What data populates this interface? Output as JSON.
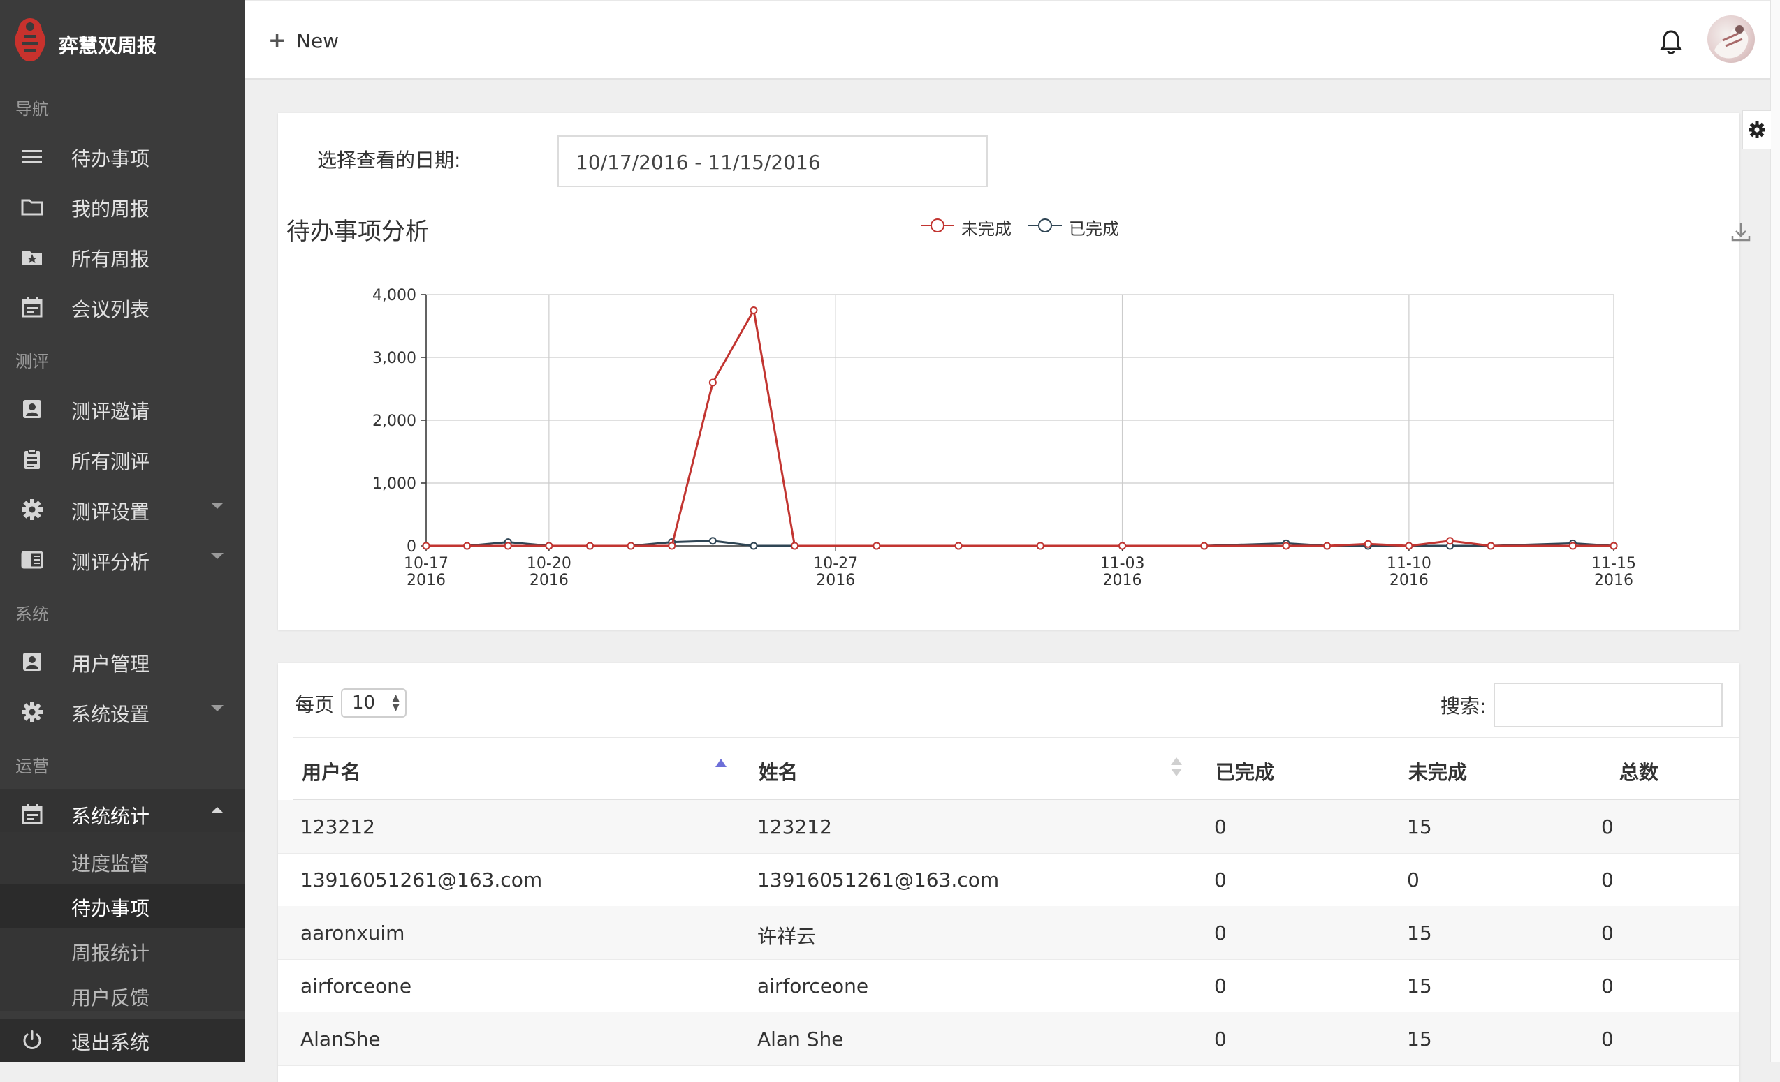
{
  "app": {
    "brand_title": "弈慧双周报",
    "logo_color": "#c8322d"
  },
  "sidebar": {
    "sections": [
      "导航",
      "测评",
      "系统",
      "运营"
    ],
    "items": [
      {
        "label": "待办事项",
        "icon": "menu-icon"
      },
      {
        "label": "我的周报",
        "icon": "folder-icon"
      },
      {
        "label": "所有周报",
        "icon": "star-folder-icon"
      },
      {
        "label": "会议列表",
        "icon": "calendar-icon"
      },
      {
        "label": "测评邀请",
        "icon": "contact-card-icon"
      },
      {
        "label": "所有测评",
        "icon": "clipboard-icon"
      },
      {
        "label": "测评设置",
        "icon": "gear-icon"
      },
      {
        "label": "测评分析",
        "icon": "reader-icon"
      },
      {
        "label": "用户管理",
        "icon": "contact-card-icon"
      },
      {
        "label": "系统设置",
        "icon": "gear-icon"
      },
      {
        "label": "系统统计",
        "icon": "calendar-icon"
      }
    ],
    "sub_items": [
      "进度监督",
      "待办事项",
      "周报统计",
      "用户反馈"
    ],
    "logout_label": "退出系统"
  },
  "topbar": {
    "new_label": "New"
  },
  "filter": {
    "date_label": "选择查看的日期:",
    "date_range": "10/17/2016 - 11/15/2016"
  },
  "chart": {
    "title": "待办事项分析",
    "legend": [
      {
        "name": "未完成",
        "color": "#c23531"
      },
      {
        "name": "已完成",
        "color": "#2f4554"
      }
    ]
  },
  "chart_data": {
    "type": "line",
    "title": "待办事项分析",
    "x": [
      "2016-10-17",
      "2016-10-18",
      "2016-10-19",
      "2016-10-20",
      "2016-10-21",
      "2016-10-22",
      "2016-10-23",
      "2016-10-24",
      "2016-10-25",
      "2016-10-26",
      "2016-10-28",
      "2016-10-30",
      "2016-11-01",
      "2016-11-03",
      "2016-11-05",
      "2016-11-07",
      "2016-11-08",
      "2016-11-09",
      "2016-11-10",
      "2016-11-11",
      "2016-11-12",
      "2016-11-14",
      "2016-11-15"
    ],
    "series": [
      {
        "name": "未完成",
        "color": "#c23531",
        "values": [
          0,
          0,
          0,
          0,
          0,
          0,
          0,
          2600,
          3750,
          0,
          0,
          0,
          0,
          0,
          0,
          0,
          0,
          30,
          0,
          80,
          0,
          0,
          0
        ]
      },
      {
        "name": "已完成",
        "color": "#2f4554",
        "values": [
          0,
          0,
          60,
          0,
          0,
          0,
          60,
          80,
          0,
          0,
          0,
          0,
          0,
          0,
          0,
          40,
          0,
          0,
          0,
          0,
          0,
          40,
          0
        ]
      }
    ],
    "x_ticks": [
      {
        "date": "2016-10-17",
        "label": "10-17",
        "year": "2016"
      },
      {
        "date": "2016-10-20",
        "label": "10-20",
        "year": "2016"
      },
      {
        "date": "2016-10-27",
        "label": "10-27",
        "year": "2016"
      },
      {
        "date": "2016-11-03",
        "label": "11-03",
        "year": "2016"
      },
      {
        "date": "2016-11-10",
        "label": "11-10",
        "year": "2016"
      },
      {
        "date": "2016-11-15",
        "label": "11-15",
        "year": "2016"
      }
    ],
    "y_ticks": [
      "0",
      "1,000",
      "2,000",
      "3,000",
      "4,000"
    ],
    "ylim": [
      0,
      4000
    ],
    "grid": true,
    "legend_position": "top-center"
  },
  "table": {
    "per_page_label": "每页",
    "per_page_value": "10",
    "search_label": "搜索:",
    "search_value": "",
    "columns": [
      "用户名",
      "姓名",
      "已完成",
      "未完成",
      "总数"
    ],
    "rows": [
      [
        "123212",
        "123212",
        "0",
        "15",
        "0"
      ],
      [
        "13916051261@163.com",
        "13916051261@163.com",
        "0",
        "0",
        "0"
      ],
      [
        "aaronxuim",
        "许祥云",
        "0",
        "15",
        "0"
      ],
      [
        "airforceone",
        "airforceone",
        "0",
        "15",
        "0"
      ],
      [
        "AlanShe",
        "Alan She",
        "0",
        "15",
        "0"
      ]
    ]
  }
}
